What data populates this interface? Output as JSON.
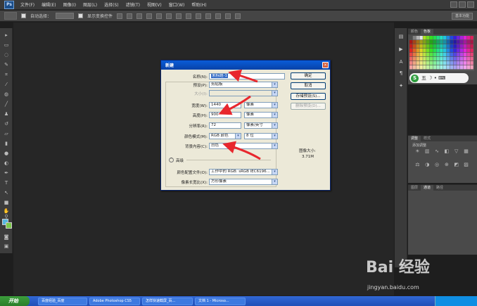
{
  "menu": {
    "logo": "Ps",
    "items": [
      "文件(F)",
      "编辑(E)",
      "图像(I)",
      "图层(L)",
      "选择(S)",
      "滤镜(T)",
      "视图(V)",
      "窗口(W)",
      "帮助(H)"
    ]
  },
  "options": {
    "auto_select": "自动选择：",
    "show_transform": "显示变换控件",
    "workspace": "基本功能"
  },
  "right_panels": {
    "color_tabs": [
      "颜色",
      "色板"
    ],
    "adjust_tabs": [
      "调整",
      "样式"
    ],
    "adjust_title": "添加调整",
    "layers_tabs": [
      "图层",
      "通道",
      "路径"
    ]
  },
  "ime": {
    "logo": "S",
    "text": "五 ☽ • ⌨"
  },
  "dialog": {
    "title": "新建",
    "name_label": "名称(N):",
    "name_value": "未标题-1",
    "preset_label": "预设(P):",
    "preset_value": "剪贴板",
    "size_label": "大小(I):",
    "width_label": "宽度(W):",
    "width_value": "1440",
    "width_unit": "像素",
    "height_label": "高度(H):",
    "height_value": "900",
    "height_unit": "像素",
    "resolution_label": "分辨率(R):",
    "resolution_value": "72",
    "resolution_unit": "像素/英寸",
    "color_mode_label": "颜色模式(M):",
    "color_mode_value": "RGB 颜色",
    "color_depth": "8 位",
    "bg_label": "背景内容(C):",
    "bg_value": "白色",
    "advanced_label": "高级",
    "profile_label": "颜色配置文件(O):",
    "profile_value": "工作中的 RGB: sRGB IEC6196...",
    "aspect_label": "像素长宽比(X):",
    "aspect_value": "方形像素",
    "ok": "确定",
    "cancel": "取消",
    "save_preset": "存储预设(S)...",
    "delete_preset": "删除预设(D)...",
    "image_size_label": "图像大小:",
    "image_size_value": "3.71M"
  },
  "taskbar": {
    "start": "开始",
    "items": [
      "百度经验_百度",
      "Adobe Photoshop CS5",
      "怎样快速截屏_百...",
      "文档 1 - Microso..."
    ]
  },
  "watermark": {
    "text": "Bai 经验",
    "sub": "jingyan.baidu.com"
  },
  "colors": {
    "accent_red": "#e8272d",
    "title_blue": "#0a5cd8",
    "dialog_bg": "#ece9d8"
  }
}
